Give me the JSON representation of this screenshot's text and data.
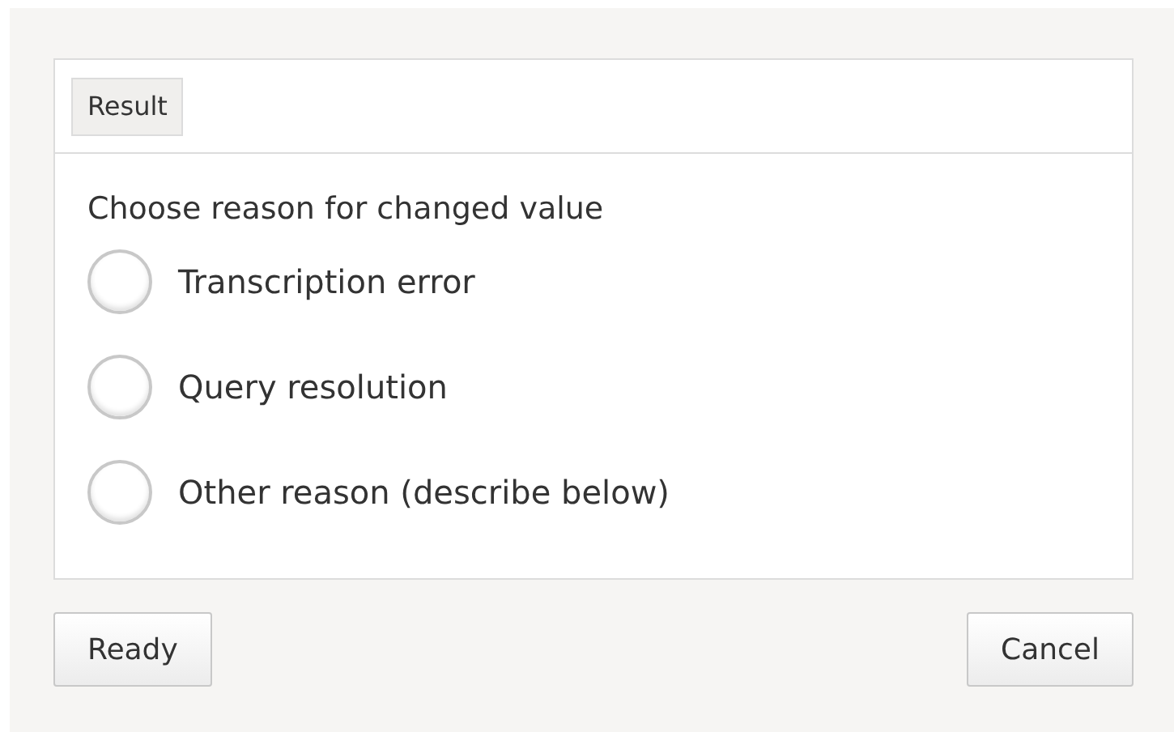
{
  "panel": {
    "tag": "Result",
    "prompt": "Choose reason for changed value",
    "options": [
      {
        "label": "Transcription error",
        "selected": false
      },
      {
        "label": "Query resolution",
        "selected": false
      },
      {
        "label": "Other reason (describe below)",
        "selected": false
      }
    ]
  },
  "buttons": [
    {
      "label": "Ready"
    },
    {
      "label": "Cancel"
    }
  ]
}
